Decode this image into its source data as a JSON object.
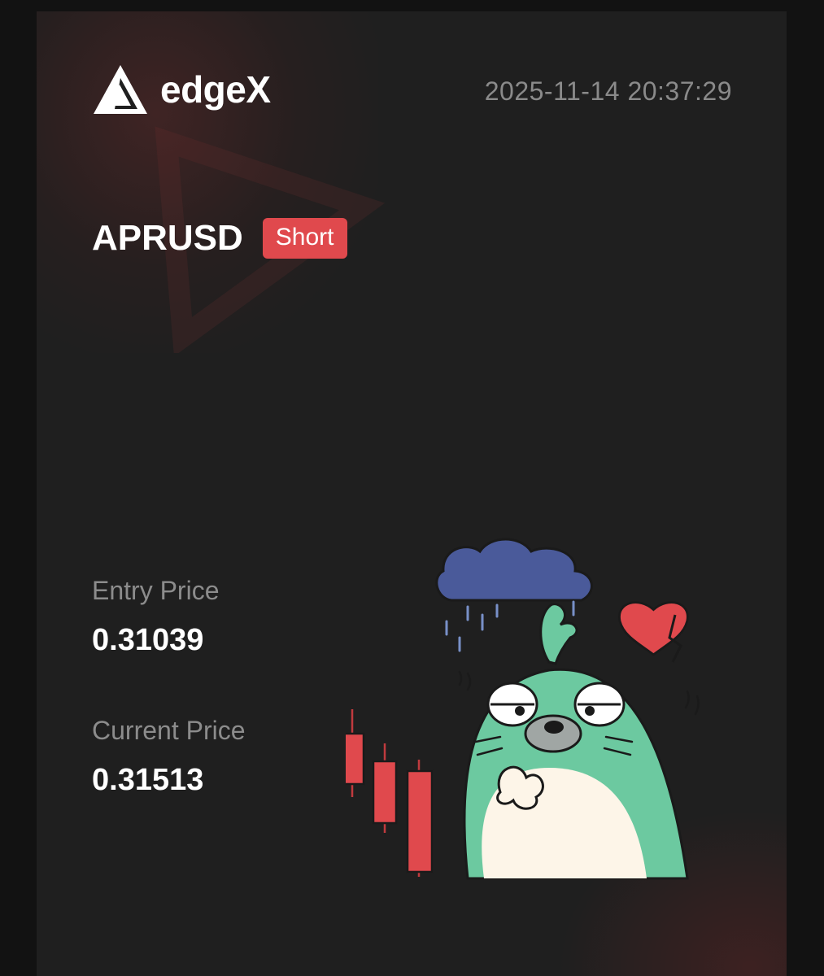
{
  "brand": {
    "name": "edgeX"
  },
  "timestamp": "2025-11-14 20:37:29",
  "position": {
    "pair": "APRUSD",
    "side": "Short"
  },
  "entry": {
    "label": "Entry Price",
    "value": "0.31039"
  },
  "current": {
    "label": "Current Price",
    "value": "0.31513"
  },
  "colors": {
    "background": "#1f1f1f",
    "short_badge": "#e0494d",
    "muted_text": "#8c8c8c",
    "mascot": "#6cc9a0",
    "cloud": "#4a5a9a"
  },
  "icons": {
    "logo": "edgex-logo-icon",
    "mascot": "sad-seal-mascot",
    "heart": "broken-heart-icon",
    "cloud": "rain-cloud-icon"
  }
}
